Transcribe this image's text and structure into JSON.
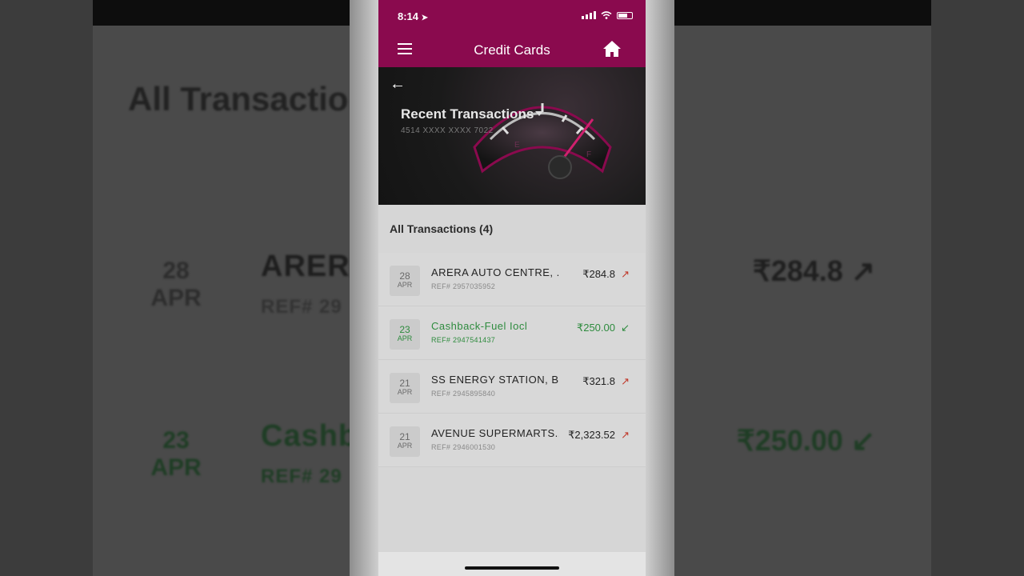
{
  "status": {
    "time": "8:14"
  },
  "nav": {
    "title": "Credit Cards"
  },
  "hero": {
    "title": "Recent Transactions",
    "card_number": "4514 XXXX XXXX 7022"
  },
  "section": {
    "title": "All Transactions (4)"
  },
  "transactions": [
    {
      "day": "28",
      "month": "APR",
      "name": "ARERA AUTO CENTRE, ...",
      "ref": "REF# 2957035952",
      "amount": "₹284.8",
      "direction": "debit"
    },
    {
      "day": "23",
      "month": "APR",
      "name": "Cashback-Fuel Iocl",
      "ref": "REF# 2947541437",
      "amount": "₹250.00",
      "direction": "credit"
    },
    {
      "day": "21",
      "month": "APR",
      "name": "SS ENERGY STATION, B...",
      "ref": "REF# 2945895840",
      "amount": "₹321.8",
      "direction": "debit"
    },
    {
      "day": "21",
      "month": "APR",
      "name": "AVENUE SUPERMARTS...",
      "ref": "REF# 2946001530",
      "amount": "₹2,323.52",
      "direction": "debit"
    }
  ],
  "background": {
    "title": "All Transactio",
    "rows": [
      {
        "day": "28",
        "month": "APR",
        "name": "ARER",
        "ref": "REF# 29",
        "amount": "₹284.8 ↗"
      },
      {
        "day": "23",
        "month": "APR",
        "name": "Cashb",
        "ref": "REF# 29",
        "amount": "₹250.00 ↙"
      }
    ]
  },
  "icons": {
    "menu": "hamburger-icon",
    "home": "home-icon",
    "back": "back-arrow-icon",
    "dropdown": "caret-down-icon",
    "debit": "arrow-up-right-icon",
    "credit": "arrow-down-left-icon"
  },
  "colors": {
    "brand": "#8a0a4e",
    "credit": "#2e8b3e",
    "debit": "#c0392b"
  }
}
